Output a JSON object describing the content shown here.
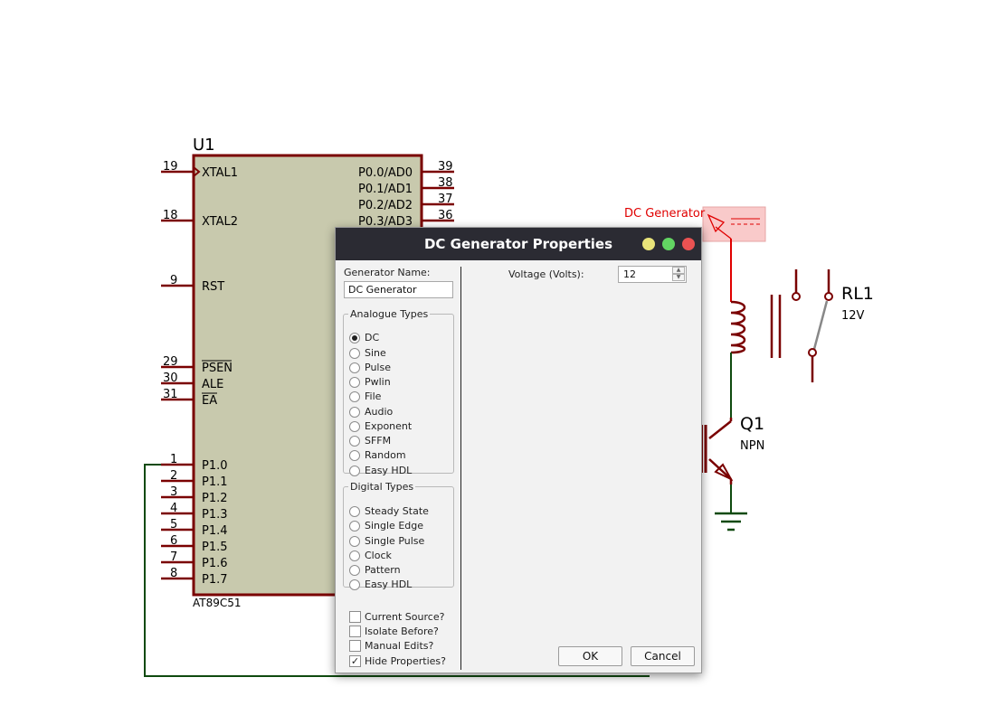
{
  "schematic": {
    "u1": {
      "ref": "U1",
      "part": "AT89C51",
      "left_pins": [
        {
          "num": "19",
          "name": "XTAL1"
        },
        {
          "num": "18",
          "name": "XTAL2"
        },
        {
          "num": "9",
          "name": "RST"
        },
        {
          "num": "29",
          "name": "PSEN"
        },
        {
          "num": "30",
          "name": "ALE"
        },
        {
          "num": "31",
          "name": "EA"
        },
        {
          "num": "1",
          "name": "P1.0"
        },
        {
          "num": "2",
          "name": "P1.1"
        },
        {
          "num": "3",
          "name": "P1.2"
        },
        {
          "num": "4",
          "name": "P1.3"
        },
        {
          "num": "5",
          "name": "P1.4"
        },
        {
          "num": "6",
          "name": "P1.5"
        },
        {
          "num": "7",
          "name": "P1.6"
        },
        {
          "num": "8",
          "name": "P1.7"
        }
      ],
      "right_pins": [
        {
          "num": "39",
          "name": "P0.0/AD0"
        },
        {
          "num": "38",
          "name": "P0.1/AD1"
        },
        {
          "num": "37",
          "name": "P0.2/AD2"
        },
        {
          "num": "36",
          "name": "P0.3/AD3"
        }
      ]
    },
    "generator_label": "DC Generator",
    "relay": {
      "ref": "RL1",
      "value": "12V"
    },
    "transistor": {
      "ref": "Q1",
      "type": "NPN"
    },
    "colors": {
      "wire": "#0f4a0f",
      "component": "#7a0000",
      "chip_fill": "#c8c9ad",
      "generator": "#e00000"
    }
  },
  "dialog": {
    "title": "DC Generator Properties",
    "generator_name_label": "Generator Name:",
    "generator_name_value": "DC Generator",
    "analogue_label": "Analogue Types",
    "analogue_types": [
      "DC",
      "Sine",
      "Pulse",
      "Pwlin",
      "File",
      "Audio",
      "Exponent",
      "SFFM",
      "Random",
      "Easy HDL"
    ],
    "analogue_selected": "DC",
    "digital_label": "Digital Types",
    "digital_types": [
      "Steady State",
      "Single Edge",
      "Single Pulse",
      "Clock",
      "Pattern",
      "Easy HDL"
    ],
    "options": [
      {
        "label": "Current Source?",
        "checked": false
      },
      {
        "label": "Isolate Before?",
        "checked": false
      },
      {
        "label": "Manual Edits?",
        "checked": false
      },
      {
        "label": "Hide Properties?",
        "checked": true
      }
    ],
    "voltage_label": "Voltage (Volts):",
    "voltage_value": "12",
    "ok_label": "OK",
    "cancel_label": "Cancel"
  }
}
